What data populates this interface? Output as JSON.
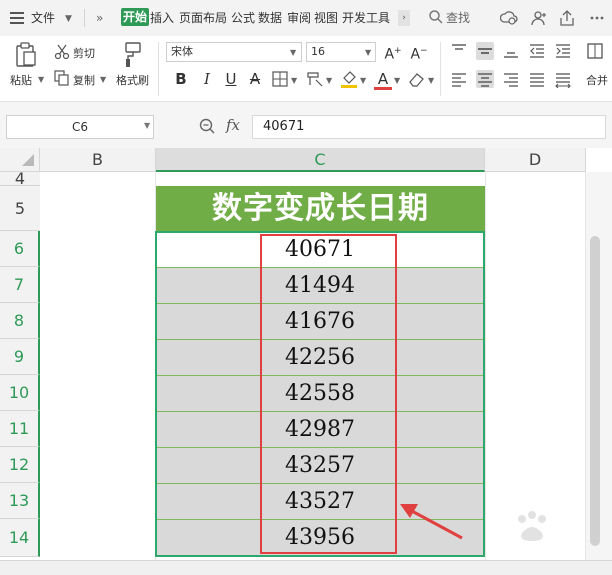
{
  "menubar": {
    "file": "文件",
    "tabs": [
      "开始",
      "插入",
      "页面布局",
      "公式",
      "数据",
      "审阅",
      "视图",
      "开发工具"
    ],
    "search": "查找"
  },
  "ribbon": {
    "paste": "粘贴",
    "cut": "剪切",
    "copy": "复制",
    "format_painter": "格式刷",
    "font_name": "宋体",
    "font_size": "16",
    "merge": "合并"
  },
  "formula_bar": {
    "cell_ref": "C6",
    "fx": "fx",
    "value": "40671"
  },
  "grid": {
    "columns": [
      "B",
      "C",
      "D"
    ],
    "rows": [
      "4",
      "5",
      "6",
      "7",
      "8",
      "9",
      "10",
      "11",
      "12",
      "13",
      "14"
    ],
    "title": "数字变成长日期",
    "values": [
      "40671",
      "41494",
      "41676",
      "42256",
      "42558",
      "42987",
      "43257",
      "43527",
      "43956"
    ]
  },
  "colors": {
    "accent": "#2f9a57",
    "title_bg": "#70ad47",
    "cell_bg": "#d9d9d9",
    "highlight": "#e0403f"
  }
}
